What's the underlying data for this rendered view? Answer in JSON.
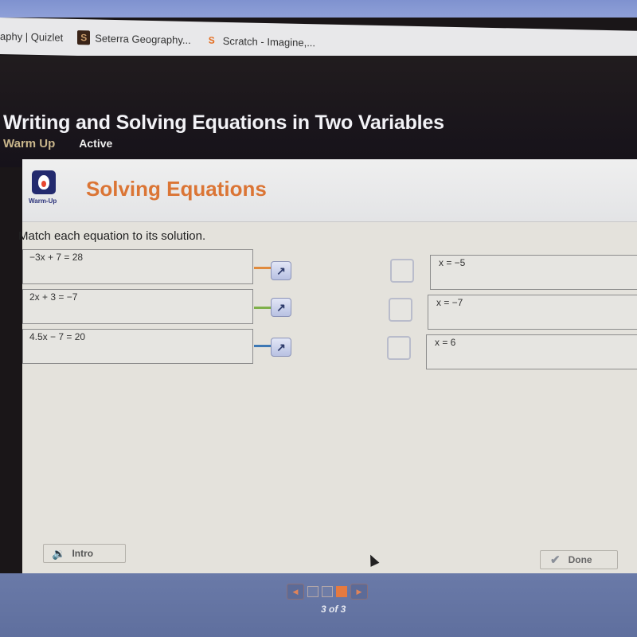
{
  "browser": {
    "bookmarks": [
      {
        "label": "aphy | Quizlet",
        "icon": "none"
      },
      {
        "label": "Seterra Geography...",
        "icon": "seterra-icon"
      },
      {
        "label": "Scratch - Imagine,...",
        "icon": "scratch-icon"
      }
    ]
  },
  "lesson": {
    "title": "Writing and Solving Equations in Two Variables",
    "type": "Warm Up",
    "status": "Active"
  },
  "activity": {
    "badge_label": "Warm-Up",
    "title": "Solving Equations",
    "instructions": "Match each equation to its solution.",
    "equations": [
      {
        "text": "−3x + 7 = 28",
        "connector_color": "#e08a3c"
      },
      {
        "text": "2x + 3 = −7",
        "connector_color": "#7fb04a"
      },
      {
        "text": "4.5x − 7 = 20",
        "connector_color": "#3d78b4"
      }
    ],
    "solutions": [
      {
        "text": "x = −5"
      },
      {
        "text": "x = −7"
      },
      {
        "text": "x = 6"
      }
    ]
  },
  "footer": {
    "intro_label": "Intro",
    "done_label": "Done"
  },
  "pager": {
    "current": 3,
    "total": 3,
    "label": "3 of 3",
    "prev_icon": "◀",
    "next_icon": "▶"
  },
  "colors": {
    "accent_orange": "#db7535",
    "warmup_navy": "#232a6e"
  }
}
